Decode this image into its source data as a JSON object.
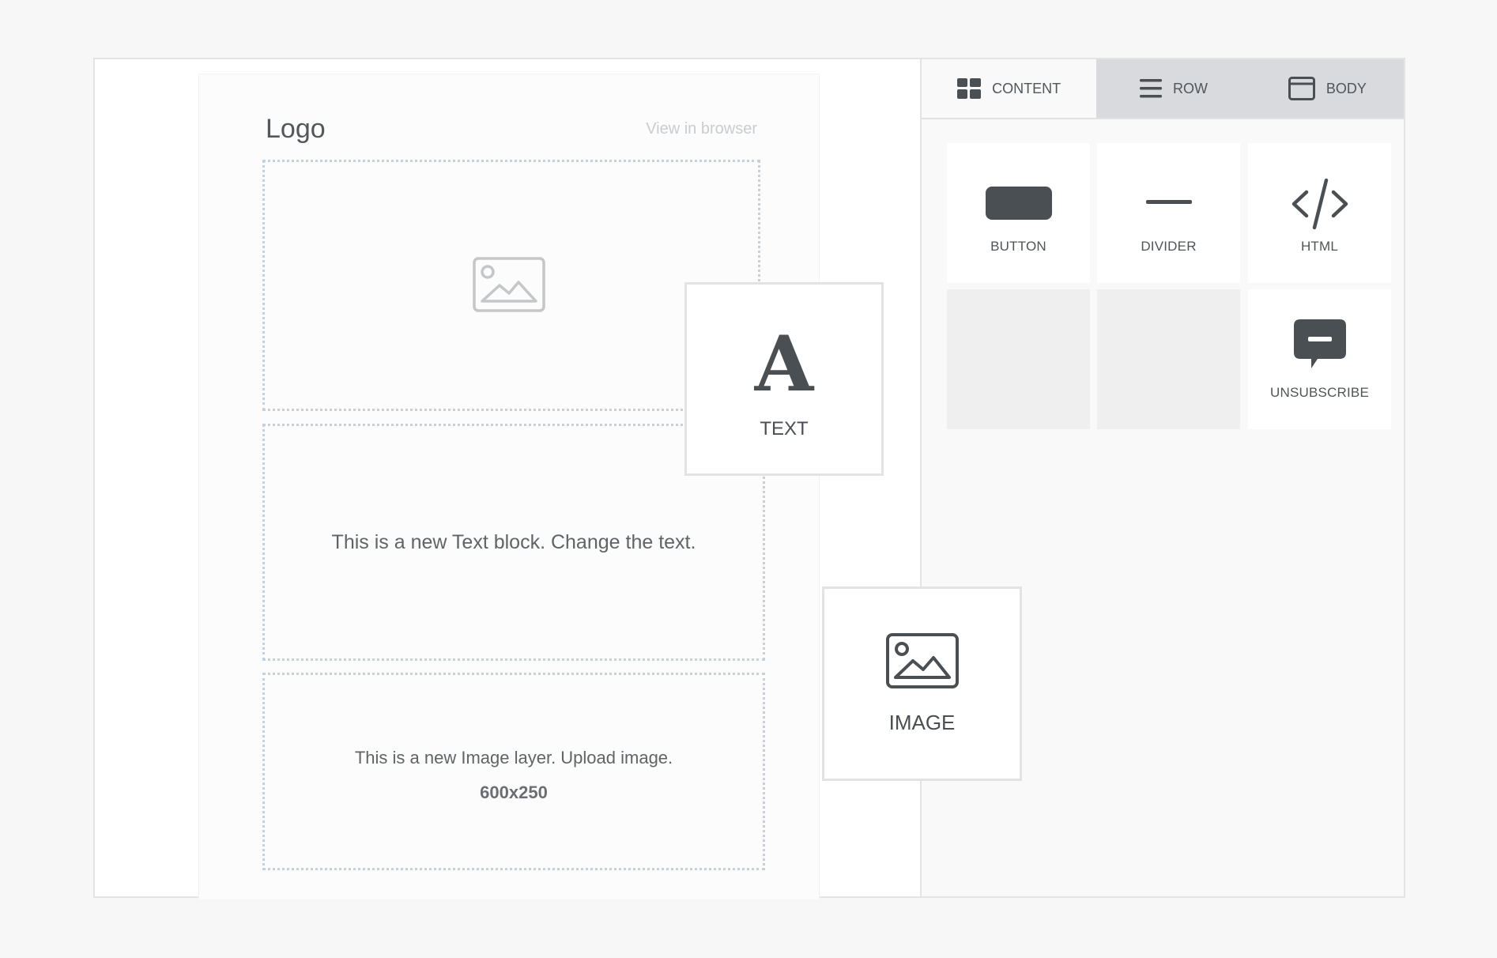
{
  "email": {
    "logo": "Logo",
    "view_in_browser": "View in browser",
    "text_block": "This is a new Text block. Change the text.",
    "image_layer": "This is a new Image layer. Upload image.",
    "image_size": "600x250"
  },
  "tabs": [
    {
      "label": "CONTENT",
      "icon": "grid-icon"
    },
    {
      "label": "ROW",
      "icon": "menu-lines-icon"
    },
    {
      "label": "BODY",
      "icon": "window-icon"
    }
  ],
  "tiles": [
    {
      "label": "BUTTON",
      "icon": "button-shape-icon"
    },
    {
      "label": "DIVIDER",
      "icon": "divider-line-icon"
    },
    {
      "label": "HTML",
      "icon": "code-brackets-icon"
    },
    {
      "label": "",
      "icon": ""
    },
    {
      "label": "",
      "icon": ""
    },
    {
      "label": "UNSUBSCRIBE",
      "icon": "chat-minus-icon"
    }
  ],
  "drag_cards": {
    "text": {
      "glyph": "A",
      "label": "TEXT"
    },
    "image": {
      "label": "IMAGE"
    }
  },
  "colors": {
    "icon_dark": "#4a4f54",
    "dotted_border": "#c7d1dc",
    "tab_bar": "#d8dadd"
  }
}
